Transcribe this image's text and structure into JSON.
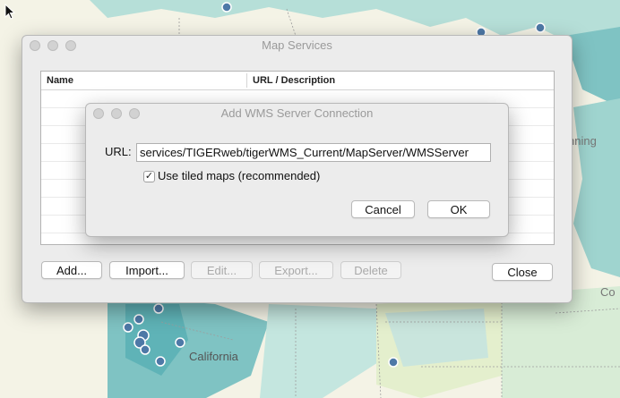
{
  "map": {
    "place_labels": [
      "California",
      "nning",
      "Co"
    ]
  },
  "map_services": {
    "title": "Map Services",
    "columns": [
      "Name",
      "URL / Description"
    ],
    "buttons": {
      "add": "Add...",
      "import": "Import...",
      "edit": "Edit...",
      "export": "Export...",
      "delete": "Delete",
      "close": "Close"
    }
  },
  "add_wms": {
    "title": "Add WMS Server Connection",
    "url_label": "URL:",
    "url_value": "services/TIGERweb/tigerWMS_Current/MapServer/WMSServer",
    "tiled_checkbox_label": "Use tiled maps (recommended)",
    "tiled_checked": true,
    "check_glyph": "✓",
    "cancel_label": "Cancel",
    "ok_label": "OK"
  },
  "cursor_glyph": "arrow-cursor-icon"
}
